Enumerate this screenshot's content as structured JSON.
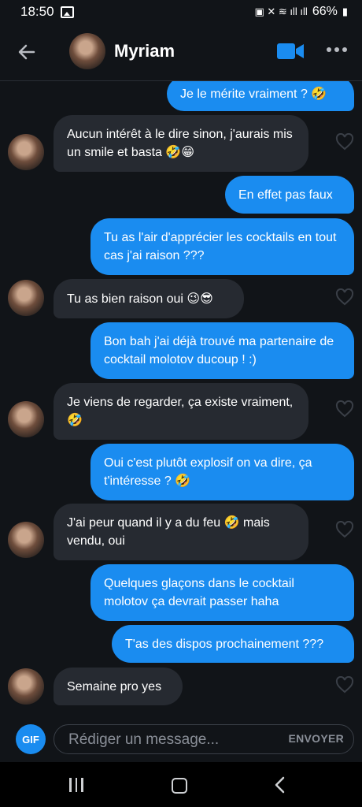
{
  "status_bar": {
    "time": "18:50",
    "battery": "66%"
  },
  "header": {
    "contact_name": "Myriam"
  },
  "messages": [
    {
      "side": "sent",
      "text": "Je le mérite vraiment ? 🤣"
    },
    {
      "side": "received",
      "text": "Aucun intérêt à le dire sinon, j'aurais mis un smile et basta 🤣😁"
    },
    {
      "side": "sent",
      "text": "En effet pas faux"
    },
    {
      "side": "sent",
      "text": "Tu as l'air d'apprécier les cocktails en tout cas j'ai raison ???"
    },
    {
      "side": "received",
      "text": "Tu as bien raison oui 😉😎"
    },
    {
      "side": "sent",
      "text": "Bon bah j'ai déjà trouvé ma partenaire de cocktail molotov ducoup ! :)"
    },
    {
      "side": "received",
      "text": "Je viens de regarder, ça existe vraiment, 🤣"
    },
    {
      "side": "sent",
      "text": "Oui c'est plutôt explosif on va dire, ça t'intéresse ? 🤣"
    },
    {
      "side": "received",
      "text": "J'ai peur quand il y a du feu 🤣 mais vendu, oui"
    },
    {
      "side": "sent",
      "text": "Quelques glaçons dans le cocktail molotov ça devrait passer haha"
    },
    {
      "side": "sent",
      "text": "T'as des dispos prochainement ???"
    },
    {
      "side": "received",
      "text": "Semaine pro yes"
    }
  ],
  "composer": {
    "gif_label": "GIF",
    "placeholder": "Rédiger un message...",
    "send_label": "ENVOYER"
  },
  "colors": {
    "accent": "#1a8cf0",
    "background": "#111418",
    "received_bubble": "#262a31"
  },
  "icons": {
    "back": "arrow-left-icon",
    "video": "video-camera-icon",
    "more": "more-dots-icon",
    "like": "heart-icon"
  }
}
